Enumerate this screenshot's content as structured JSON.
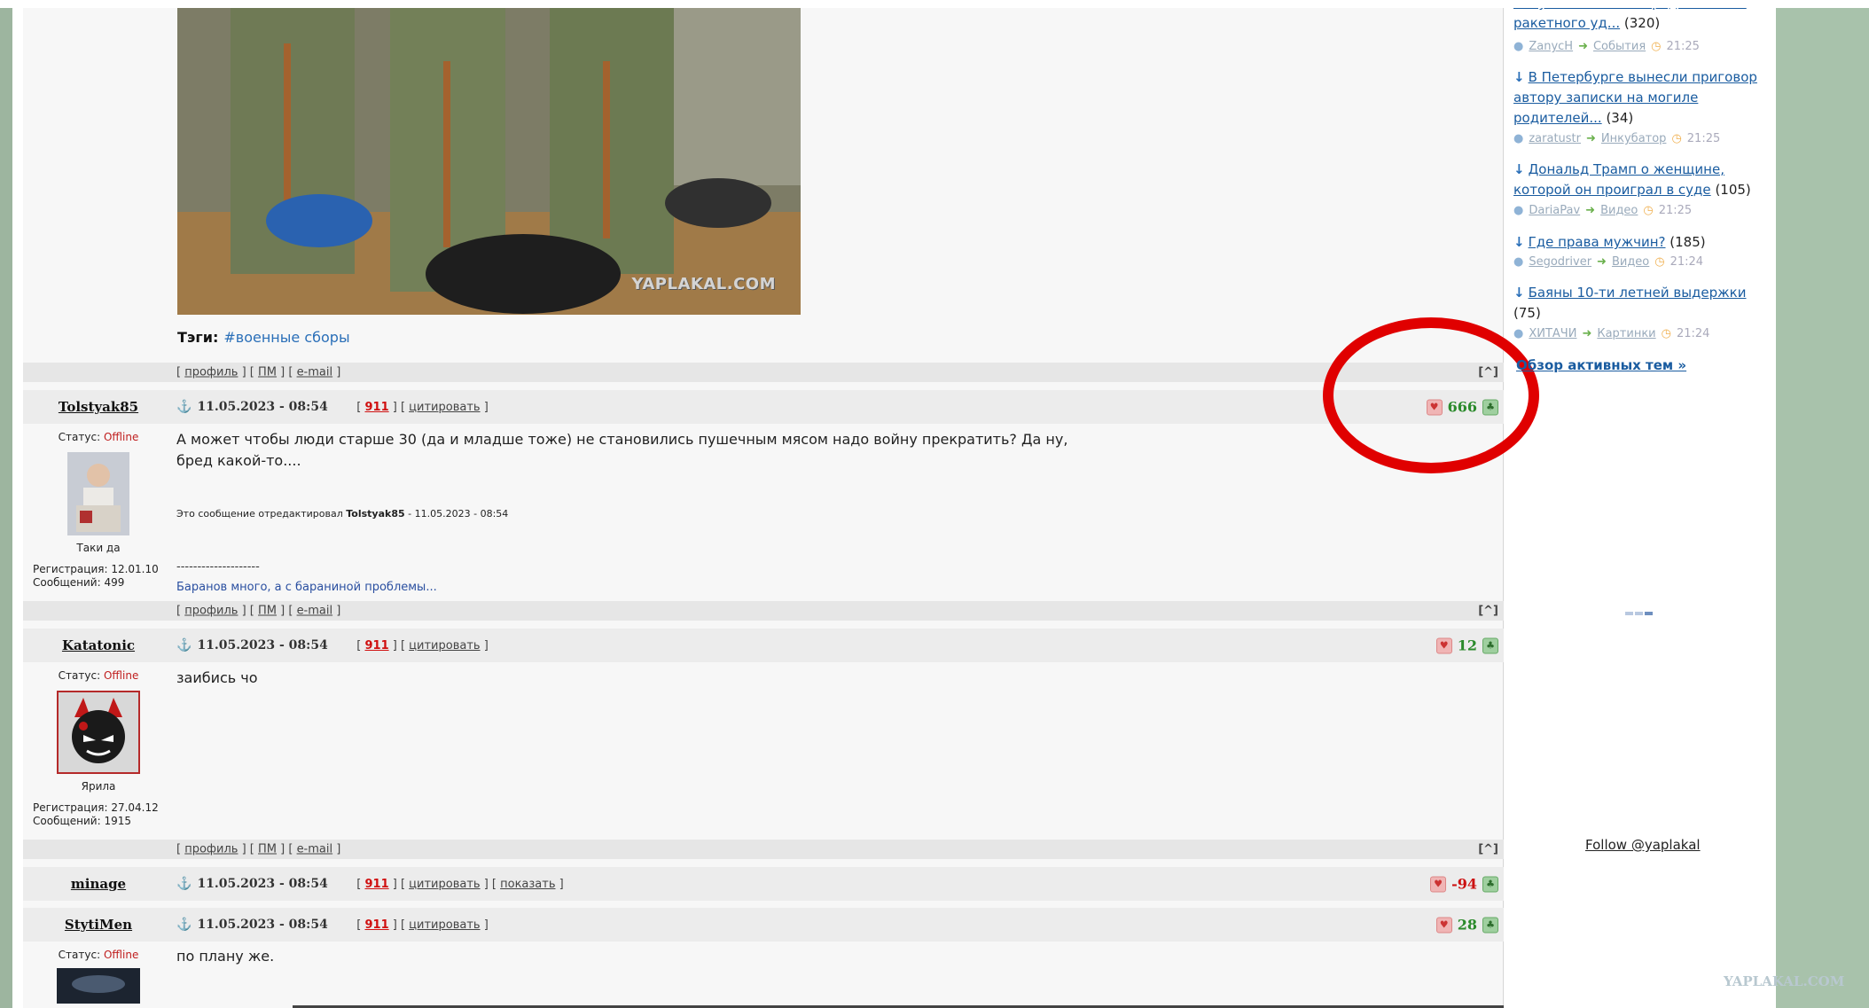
{
  "tags": {
    "label": "Тэги:",
    "value": "#военные сборы"
  },
  "photo_watermark": "YAPLAKAL.COM",
  "profile_links": {
    "profile": "профиль",
    "pm": "ПМ",
    "email": "e-mail",
    "up": "[^]"
  },
  "posts": [
    {
      "nick": "Tolstyak85",
      "date": "11.05.2023 - 08:54",
      "num": "911",
      "quote": "цитировать",
      "rating": "666",
      "status_label": "Статус:",
      "status": "Offline",
      "avatar_caption": "Таки да",
      "reg": "Регистрация: 12.01.10",
      "msgs": "Сообщений: 499",
      "text_line1": "А может чтобы люди старше 30 (да и младше тоже) не становились пушечным мясом надо войну прекратить? Да ну,",
      "text_line2": "бред какой-то....",
      "edit_prefix": "Это сообщение отредактировал",
      "edit_user": "Tolstyak85",
      "edit_date": "- 11.05.2023 - 08:54",
      "sig_line": "--------------------",
      "signature": "Баранов много, а с бараниной проблемы..."
    },
    {
      "nick": "Katatonic",
      "date": "11.05.2023 - 08:54",
      "num": "911",
      "quote": "цитировать",
      "rating": "12",
      "status_label": "Статус:",
      "status": "Offline",
      "avatar_caption": "Ярила",
      "reg": "Регистрация: 27.04.12",
      "msgs": "Сообщений: 1915",
      "text_line1": "заибись чо"
    },
    {
      "nick": "minage",
      "date": "11.05.2023 - 08:54",
      "num": "911",
      "quote": "цитировать",
      "show": "показать",
      "rating": "-94"
    },
    {
      "nick": "StytiMen",
      "date": "11.05.2023 - 08:54",
      "num": "911",
      "quote": "цитировать",
      "rating": "28",
      "status_label": "Статус:",
      "status": "Offline",
      "text_line1": "по плану же."
    }
  ],
  "sidebar": {
    "items": [
      {
        "title": "Залужный мог пострадать после ракетного уд...",
        "count": "(320)",
        "user": "ZanycH",
        "section": "События",
        "time": "21:25"
      },
      {
        "title": "В Петербурге вынесли приговор автору записки на могиле родителей...",
        "count": "(34)",
        "user": "zaratustr",
        "section": "Инкубатор",
        "time": "21:25"
      },
      {
        "title": "Дональд Трамп о женщине, которой он проиграл в суде",
        "count": "(105)",
        "user": "DariaPav",
        "section": "Видео",
        "time": "21:25"
      },
      {
        "title": "Где права мужчин?",
        "count": "(185)",
        "user": "Segodriver",
        "section": "Видео",
        "time": "21:24"
      },
      {
        "title": "Баяны 10-ти летней выдержки",
        "count": "(75)",
        "user": "ХИТАЧИ",
        "section": "Картинки",
        "time": "21:24"
      }
    ],
    "overview": "Обзор активных тем »",
    "follow": "Follow @yaplakal"
  },
  "site_watermark": "YAPLAKAL.COM",
  "colors": {
    "sage": "#9db59f",
    "link": "#1a5ca0",
    "offline": "#c02020",
    "rating_pos": "#2b8a2b",
    "rating_neg": "#cc1111",
    "highlight_circle": "#e00000"
  }
}
